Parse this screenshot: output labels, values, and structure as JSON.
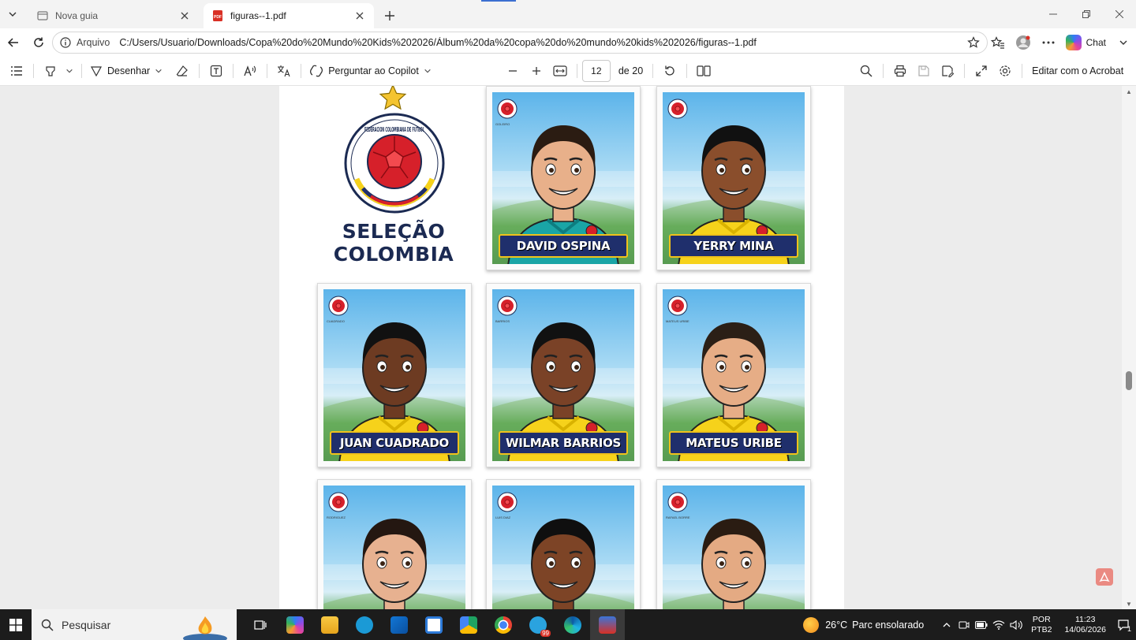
{
  "tabs": [
    {
      "title": "Nova guia",
      "active": false,
      "icon": "new-tab-page-icon"
    },
    {
      "title": "figuras--1.pdf",
      "active": true,
      "icon": "pdf-file-icon"
    }
  ],
  "address": {
    "scheme_label": "Arquivo",
    "url": "C:/Users/Usuario/Downloads/Copa%20do%20Mundo%20Kids%202026/Álbum%20da%20copa%20do%20mundo%20kids%202026/figuras--1.pdf"
  },
  "nav_right": {
    "chat_label": "Chat"
  },
  "pdf_toolbar": {
    "draw_label": "Desenhar",
    "copilot_label": "Perguntar ao Copilot",
    "current_page": "12",
    "page_total_label": "de 20",
    "acrobat_label": "Editar com o Acrobat"
  },
  "album": {
    "team_title_line1": "SELEÇÃO",
    "team_title_line2": "COLOMBIA",
    "crest_text": "FEDERACION COLOMBIANA DE FUTBOL",
    "stickers": [
      {
        "name": "DAVID OSPINA",
        "tiny": "GOLEIRO",
        "kit": "teal"
      },
      {
        "name": "YERRY MINA",
        "tiny": "",
        "kit": "yellow"
      },
      {
        "name": "JUAN CUADRADO",
        "tiny": "CUADRADO",
        "kit": "yellow"
      },
      {
        "name": "WILMAR BARRIOS",
        "tiny": "BARRIOS",
        "kit": "yellow"
      },
      {
        "name": "MATEUS URIBE",
        "tiny": "MATEUS URIBE",
        "kit": "yellow"
      },
      {
        "name": "",
        "tiny": "RODRIGUEZ",
        "kit": "yellow"
      },
      {
        "name": "",
        "tiny": "LUIS DIAZ",
        "kit": "yellow"
      },
      {
        "name": "",
        "tiny": "RAFAEL BORRE",
        "kit": "yellow"
      }
    ]
  },
  "taskbar": {
    "search_placeholder": "Pesquisar",
    "weather_temp": "26°C",
    "weather_desc": "Parc ensolarado",
    "lang_line1": "POR",
    "lang_line2": "PTB2",
    "time": "11:23",
    "date": "14/06/2026",
    "notification_count": "1",
    "badge_count": "99"
  },
  "colors": {
    "accent": "#3c6fd1",
    "colombia_yellow": "#f6d21b",
    "colombia_blue": "#1f2f6c",
    "colombia_red": "#d6202a"
  }
}
